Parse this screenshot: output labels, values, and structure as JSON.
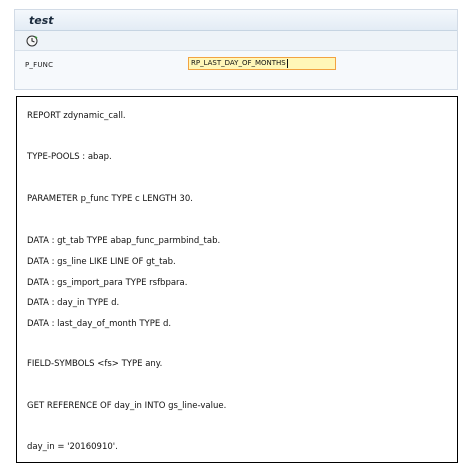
{
  "screen": {
    "title": "test",
    "toolbar": {
      "execute_icon": "execute-clock-icon"
    },
    "param": {
      "label": "P_FUNC",
      "value": "RP_LAST_DAY_OF_MONTHS"
    }
  },
  "code": {
    "lines": [
      "REPORT zdynamic_call.",
      "TYPE-POOLS : abap.",
      "PARAMETER p_func TYPE c LENGTH 30.",
      "DATA : gt_tab TYPE abap_func_parmbind_tab.",
      "DATA : gs_line LIKE LINE OF gt_tab.",
      "DATA : gs_import_para TYPE rsfbpara.",
      "DATA : day_in TYPE d.",
      "DATA : last_day_of_month TYPE d.",
      "FIELD-SYMBOLS <fs> TYPE any.",
      "GET REFERENCE OF day_in INTO gs_line-value.",
      "day_in = '20160910'."
    ]
  },
  "colors": {
    "accent_input_bg": "#fff7b8",
    "accent_input_border": "#f2a341",
    "panel_border": "#d2dbe6"
  }
}
